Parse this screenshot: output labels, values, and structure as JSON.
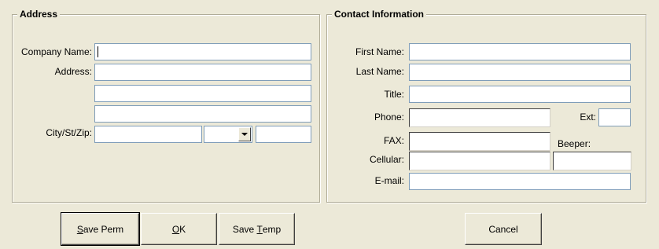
{
  "address": {
    "title": "Address",
    "company_name_label": "Company Name:",
    "company_name_value": "",
    "address_label": "Address:",
    "address_line1_value": "",
    "address_line2_value": "",
    "address_line3_value": "",
    "city_st_zip_label": "City/St/Zip:",
    "city_value": "",
    "state_value": "",
    "zip_value": ""
  },
  "contact": {
    "title": "Contact Information",
    "first_name_label": "First Name:",
    "first_name_value": "",
    "last_name_label": "Last Name:",
    "last_name_value": "",
    "title_label": "Title:",
    "title_value": "",
    "phone_label": "Phone:",
    "phone_value": "",
    "ext_label": "Ext:",
    "ext_value": "",
    "fax_label": "FAX:",
    "fax_value": "",
    "beeper_label": "Beeper:",
    "beeper_value": "",
    "cellular_label": "Cellular:",
    "cellular_value": "",
    "email_label": "E-mail:",
    "email_value": ""
  },
  "buttons": {
    "save_perm": {
      "mnemonic": "S",
      "rest": "ave Perm"
    },
    "ok": {
      "mnemonic": "O",
      "rest": "K"
    },
    "save_temp": {
      "prefix": "Save ",
      "mnemonic": "T",
      "rest": "emp"
    },
    "cancel": "Cancel"
  },
  "icons": {
    "dropdown": "chevron-down-icon"
  }
}
